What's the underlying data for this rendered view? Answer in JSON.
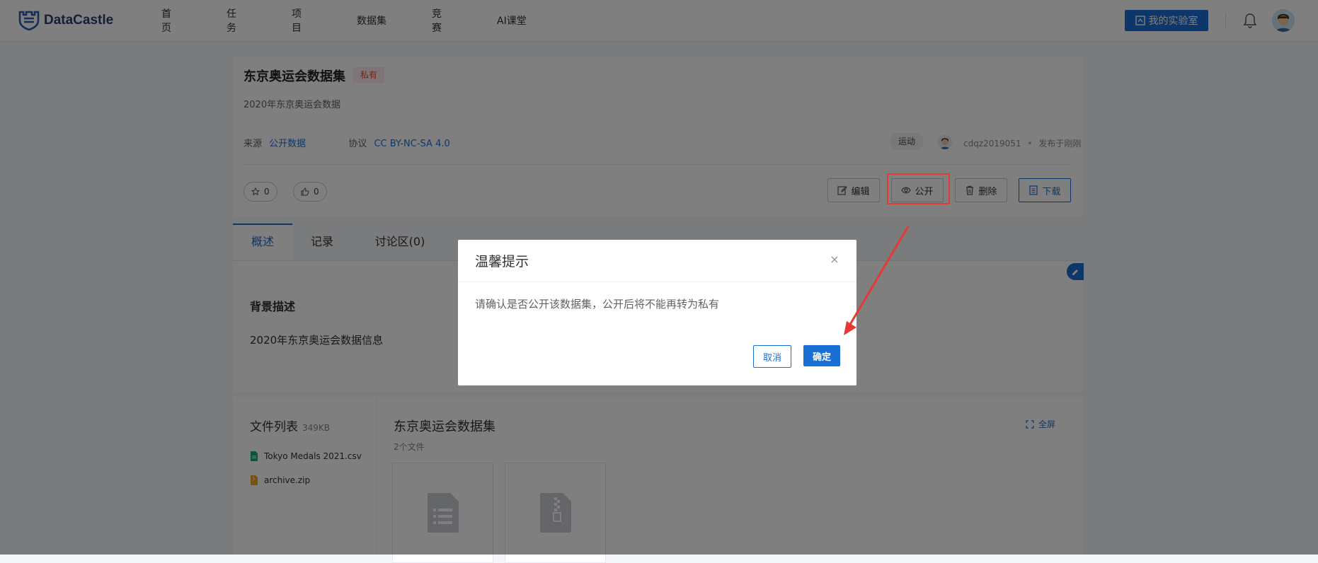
{
  "nav": {
    "logo_text": "DataCastle",
    "items": [
      "首页",
      "任务",
      "项目",
      "数据集",
      "竞赛",
      "AI课堂"
    ],
    "lab_button": "我的实验室"
  },
  "dataset": {
    "title": "东京奥运会数据集",
    "visibility_tag": "私有",
    "subtitle": "2020年东京奥运会数据",
    "source_label": "来源",
    "source_value": "公开数据",
    "license_label": "协议",
    "license_value": "CC BY-NC-SA 4.0",
    "category_tag": "运动",
    "author": "cdqz2019051",
    "published": "发布于刚刚",
    "star_count": "0",
    "like_count": "0",
    "actions": {
      "edit": "编辑",
      "public": "公开",
      "delete": "删除",
      "download": "下载"
    }
  },
  "tabs": [
    "概述",
    "记录",
    "讨论区(0)"
  ],
  "overview": {
    "section_title": "背景描述",
    "section_body": "2020年东京奥运会数据信息"
  },
  "files": {
    "title": "文件列表",
    "size": "349KB",
    "items": [
      "Tokyo Medals 2021.csv",
      "archive.zip"
    ],
    "right_title": "东京奥运会数据集",
    "count": "2个文件",
    "fullscreen": "全屏"
  },
  "modal": {
    "title": "温馨提示",
    "message": "请确认是否公开该数据集，公开后将不能再转为私有",
    "cancel": "取消",
    "confirm": "确定"
  },
  "colors": {
    "accent": "#1a6fd4",
    "private_tag": "#e0483d",
    "highlight": "#e53935"
  }
}
